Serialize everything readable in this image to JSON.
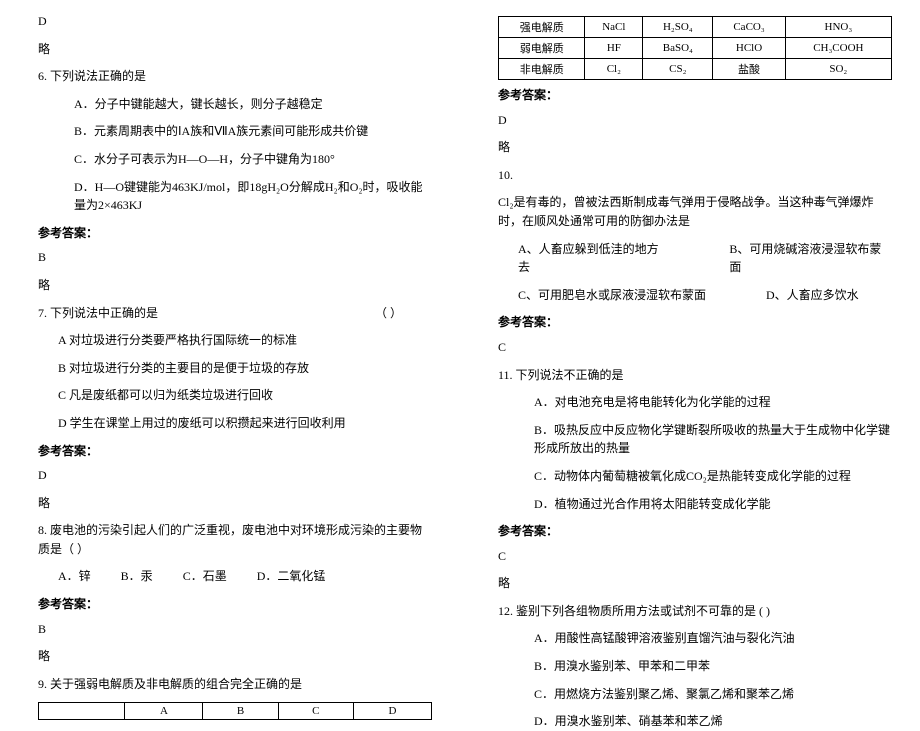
{
  "left": {
    "prev_ans_letter": "D",
    "prev_omit": "略",
    "q6": {
      "stem": "6. 下列说法正确的是",
      "optA": "A．分子中键能越大，键长越长，则分子越稳定",
      "optB": "B．元素周期表中的ⅠA族和ⅦA族元素间可能形成共价键",
      "optC": "C．水分子可表示为H—O—H，分子中键角为180°",
      "optD": "D．H—O键键能为463KJ/mol，即18gH₂O分解成H₂和O₂时，吸收能量为2×463KJ",
      "ans_label": "参考答案：",
      "ans": "B",
      "omit": "略"
    },
    "q7": {
      "stem": "7. 下列说法中正确的是",
      "blank": "（        ）",
      "optA": "A   对垃圾进行分类要严格执行国际统一的标准",
      "optB": "B   对垃圾进行分类的主要目的是便于垃圾的存放",
      "optC": "C   凡是废纸都可以归为纸类垃圾进行回收",
      "optD": "D   学生在课堂上用过的废纸可以积攒起来进行回收利用",
      "ans_label": "参考答案：",
      "ans": "D",
      "omit": "略"
    },
    "q8": {
      "stem": "8. 废电池的污染引起人们的广泛重视，废电池中对环境形成污染的主要物质是（   ）",
      "optA": "A．锌",
      "optB": "B．汞",
      "optC": "C．石墨",
      "optD": "D．二氧化锰",
      "ans_label": "参考答案：",
      "ans": "B",
      "omit": "略"
    },
    "q9": {
      "stem": "9. 关于强弱电解质及非电解质的组合完全正确的是",
      "headers": [
        "",
        "A",
        "B",
        "C",
        "D"
      ]
    }
  },
  "right": {
    "table": {
      "headers": [
        "",
        "A",
        "B",
        "C",
        "D"
      ],
      "rows": [
        {
          "label": "强电解质",
          "cells": [
            "NaCl",
            "H₂SO₄",
            "CaCO₃",
            "HNO₃"
          ]
        },
        {
          "label": "弱电解质",
          "cells": [
            "HF",
            "BaSO₄",
            "HClO",
            "CH₃COOH"
          ]
        },
        {
          "label": "非电解质",
          "cells": [
            "Cl₂",
            "CS₂",
            "盐酸",
            "SO₂"
          ]
        }
      ]
    },
    "q9ans": {
      "ans_label": "参考答案：",
      "ans": "D",
      "omit": "略"
    },
    "q10": {
      "num": "10.",
      "stem": "Cl₂是有毒的，曾被法西斯制成毒气弹用于侵略战争。当这种毒气弹爆炸时，在顺风处通常可用的防御办法是",
      "optA": "A、人畜应躲到低洼的地方去",
      "optB": "B、可用烧碱溶液浸湿软布蒙面",
      "optC": "C、可用肥皂水或尿液浸湿软布蒙面",
      "optD": "D、人畜应多饮水",
      "ans_label": "参考答案：",
      "ans": "C"
    },
    "q11": {
      "stem": "11. 下列说法不正确的是",
      "optA": "A．对电池充电是将电能转化为化学能的过程",
      "optB": "B．吸热反应中反应物化学键断裂所吸收的热量大于生成物中化学键形成所放出的热量",
      "optC": "C．动物体内葡萄糖被氧化成CO₂是热能转变成化学能的过程",
      "optD": "D．植物通过光合作用将太阳能转变成化学能",
      "ans_label": "参考答案：",
      "ans": "C",
      "omit": "略"
    },
    "q12": {
      "stem": "12. 鉴别下列各组物质所用方法或试剂不可靠的是    (    )",
      "optA": "A．用酸性高锰酸钾溶液鉴别直馏汽油与裂化汽油",
      "optB": "B．用溴水鉴别苯、甲苯和二甲苯",
      "optC": "C．用燃烧方法鉴别聚乙烯、聚氯乙烯和聚苯乙烯",
      "optD": "D．用溴水鉴别苯、硝基苯和苯乙烯"
    }
  }
}
